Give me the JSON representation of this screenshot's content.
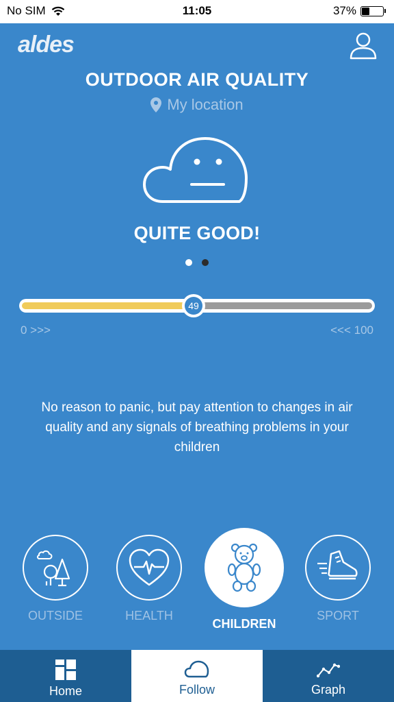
{
  "status_bar": {
    "carrier": "No SIM",
    "time": "11:05",
    "battery": "37%",
    "battery_level": 0.37,
    "icons": [
      "wifi-icon",
      "battery-icon"
    ]
  },
  "header": {
    "logo": "aldes",
    "user_icon": "user-icon"
  },
  "title": "OUTDOOR AIR QUALITY",
  "location": {
    "icon": "location-pin-icon",
    "label": "My location"
  },
  "quality": {
    "icon": "cloud-face-neutral-icon",
    "label": "QUITE GOOD!",
    "value": 49,
    "value_label": "49",
    "min_label": "0 >>>",
    "max_label": "<<< 100",
    "range": [
      0,
      100
    ]
  },
  "pager": {
    "count": 2,
    "active_index": 0
  },
  "advice": "No reason to panic, but pay attention to changes in air quality and any signals of breathing problems in your children",
  "categories": [
    {
      "label": "OUTSIDE",
      "icon": "trees-icon",
      "active": false
    },
    {
      "label": "HEALTH",
      "icon": "heart-pulse-icon",
      "active": false
    },
    {
      "label": "CHILDREN",
      "icon": "teddy-bear-icon",
      "active": true
    },
    {
      "label": "SPORT",
      "icon": "running-shoe-icon",
      "active": false
    }
  ],
  "tabs": [
    {
      "label": "Home",
      "icon": "grid-icon",
      "active": false
    },
    {
      "label": "Follow",
      "icon": "cloud-icon",
      "active": true
    },
    {
      "label": "Graph",
      "icon": "line-graph-icon",
      "active": false
    }
  ],
  "colors": {
    "background": "#3a87cb",
    "slider_fill": "#f0cb5a",
    "slider_rest": "#9b9b9b",
    "tabbar": "#1e5e92"
  }
}
